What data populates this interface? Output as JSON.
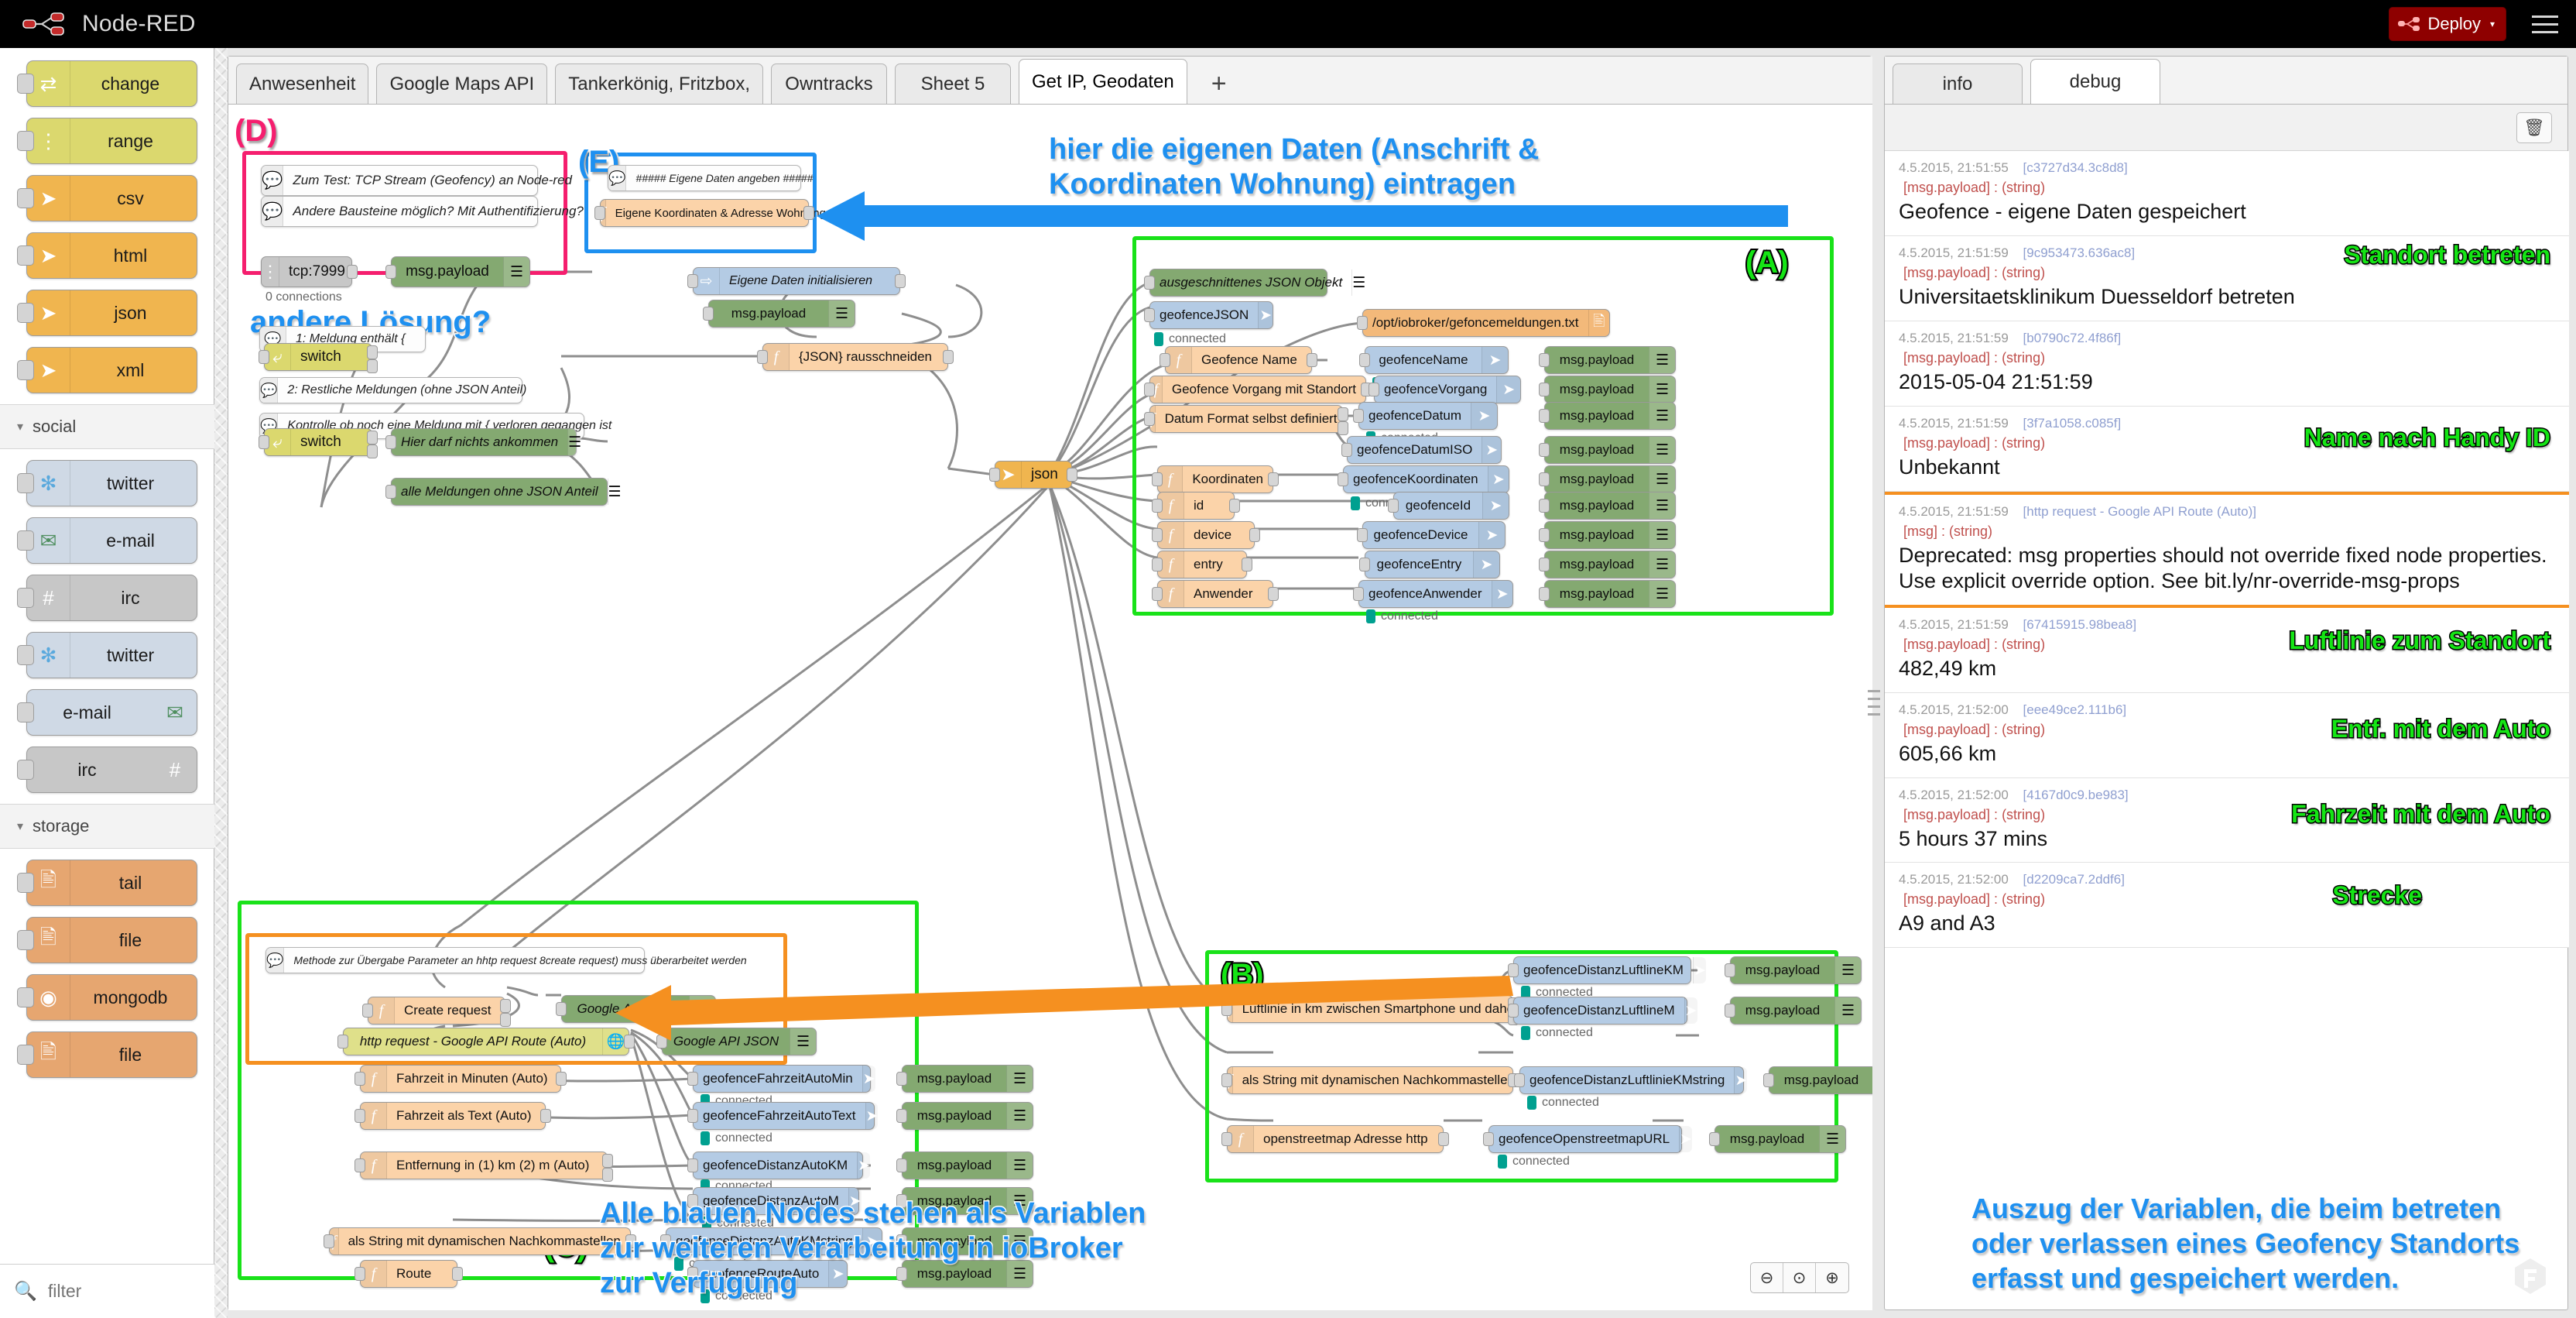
{
  "header": {
    "app_title": "Node-RED",
    "deploy_label": "Deploy",
    "deploy_caret": "▾",
    "logo_icon": "node-red-logo-icon",
    "menu_icon": "hamburger-menu-icon"
  },
  "palette": {
    "filter_placeholder": "filter",
    "filter_value": "",
    "search_icon": "search-icon",
    "groups": [
      {
        "label": "",
        "nodes": [
          {
            "label": "change",
            "color": "yellow",
            "icon": "change-icon"
          },
          {
            "label": "range",
            "color": "yellow",
            "icon": "range-icon"
          },
          {
            "label": "csv",
            "color": "orange",
            "icon": "arrow-right-icon"
          },
          {
            "label": "html",
            "color": "orange",
            "icon": "arrow-right-icon"
          },
          {
            "label": "json",
            "color": "orange",
            "icon": "arrow-right-icon"
          },
          {
            "label": "xml",
            "color": "orange",
            "icon": "arrow-right-icon"
          }
        ]
      },
      {
        "label": "social",
        "caret": "▾",
        "nodes": [
          {
            "label": "twitter",
            "color": "lightblue",
            "icon": "twitter-icon"
          },
          {
            "label": "e-mail",
            "color": "lightblue",
            "icon": "envelope-icon"
          },
          {
            "label": "irc",
            "color": "grey",
            "icon": "hash-icon"
          },
          {
            "label": "twitter",
            "color": "lightblue",
            "icon": "twitter-icon"
          },
          {
            "label": "e-mail",
            "color": "lightblue",
            "icon": "envelope-icon"
          },
          {
            "label": "irc",
            "color": "grey",
            "icon": "hash-icon"
          }
        ]
      },
      {
        "label": "storage",
        "caret": "▾",
        "nodes": [
          {
            "label": "tail",
            "color": "tan",
            "icon": "file-icon"
          },
          {
            "label": "file",
            "color": "tan",
            "icon": "file-icon"
          },
          {
            "label": "mongodb",
            "color": "tan",
            "icon": "db-icon"
          },
          {
            "label": "file",
            "color": "tan",
            "icon": "file-icon"
          }
        ]
      }
    ]
  },
  "editor": {
    "tabs": [
      {
        "label": "Anwesenheit",
        "active": false
      },
      {
        "label": "Google Maps API",
        "active": false
      },
      {
        "label": "Tankerkönig, Fritzbox,",
        "active": false
      },
      {
        "label": "Owntracks",
        "active": false
      },
      {
        "label": "Sheet 5",
        "active": false
      },
      {
        "label": "Get IP, Geodaten",
        "active": true
      }
    ],
    "add_tab_label": "+",
    "zoom_controls": [
      {
        "icon": "zoom-out-icon",
        "glyph": "⊖"
      },
      {
        "icon": "zoom-reset-icon",
        "glyph": "⊙"
      },
      {
        "icon": "zoom-in-icon",
        "glyph": "⊕"
      }
    ],
    "group_labels": {
      "a": "(A)",
      "b": "(B)",
      "c": "(C)",
      "d": "(D)",
      "e": "(E)"
    },
    "annotations": {
      "eigene_daten": "hier die eigenen Daten (Anschrift &\nKoordinaten Wohnung) eintragen",
      "andere_loesung": "andere Lösung?",
      "blaue_nodes": "Alle blauen Nodes stehen als Variablen\nzur weiteren Verarbeitung in ioBroker\nzur Verfügung"
    },
    "nodes": {
      "tcp_comment_1": "Zum Test: TCP Stream (Geofency) an Node-red",
      "tcp_comment_2": "Andere Bausteine möglich? Mit Authentifizierung?",
      "tcp_in": "tcp:7999",
      "tcp_status": "0 connections",
      "tcp_debug": "msg.payload",
      "e_comment": "##### Eigene Daten angeben #####",
      "e_func": "Eigene Koordinaten & Adresse Wohnung",
      "init_inject": "Eigene Daten initialisieren",
      "init_debug": "msg.payload",
      "sw1_comment": "1: Meldung enthält {",
      "sw1": "switch",
      "sw1_comment2": "2: Restliche Meldungen (ohne JSON Anteil)",
      "json_cut": "{JSON} rausschneiden",
      "sw2_comment": "Kontrolle ob noch eine Meldung mit { verloren gegangen ist",
      "sw2": "switch",
      "sw2_debug1": "Hier darf nichts ankommen",
      "sw2_debug2": "alle Meldungen ohne JSON Anteil",
      "json_node": "json",
      "a_debug_cut": "ausgeschnittenes JSON Objekt",
      "a_var_json": "geofenceJSON",
      "a_file": "/opt/iobroker/gefoncemeldungen.txt",
      "connected": "connected",
      "rows_a": [
        {
          "func": "Geofence Name",
          "var": "geofenceName",
          "debug": "msg.payload"
        },
        {
          "func": "Geofence Vorgang mit Standort",
          "var": "geofenceVorgang",
          "debug": "msg.payload"
        },
        {
          "func": "Datum Format selbst definiert",
          "var": "geofenceDatum",
          "debug": "msg.payload"
        },
        {
          "func": "",
          "var": "geofenceDatumISO",
          "debug": "msg.payload"
        },
        {
          "func": "Koordinaten",
          "var": "geofenceKoordinaten",
          "debug": "msg.payload"
        },
        {
          "func": "id",
          "var": "geofenceId",
          "debug": "msg.payload"
        },
        {
          "func": "device",
          "var": "geofenceDevice",
          "debug": "msg.payload"
        },
        {
          "func": "entry",
          "var": "geofenceEntry",
          "debug": "msg.payload"
        },
        {
          "func": "Anwender",
          "var": "geofenceAnwender",
          "debug": "msg.payload"
        }
      ],
      "c_comment": "Methode zur Übergabe Parameter an hhtp request 8create request) muss überarbeitet werden",
      "c_create_request": "Create request",
      "c_google_url_debug": "Google API URL",
      "c_http_request": "http request - Google API Route (Auto)",
      "c_google_json_debug": "Google API JSON",
      "rows_c": [
        {
          "func": "Fahrzeit in Minuten (Auto)",
          "var": "geofenceFahrzeitAutoMin",
          "debug": "msg.payload"
        },
        {
          "func": "Fahrzeit als Text (Auto)",
          "var": "geofenceFahrzeitAutoText",
          "debug": "msg.payload"
        },
        {
          "func": "Entfernung in (1) km (2) m (Auto)",
          "var": "geofenceDistanzAutoKM",
          "debug": "msg.payload"
        },
        {
          "func": "",
          "var": "geofenceDistanzAutoM",
          "debug": "msg.payload"
        },
        {
          "func": "als String mit dynamischen Nachkommastellen",
          "var": "geofenceDistanzAutoKMstring",
          "debug": "msg.payload"
        },
        {
          "func": "Route",
          "var": "geofenceRouteAuto",
          "debug": "msg.payload"
        }
      ],
      "rows_b": [
        {
          "func": "Luftlinie in km zwischen Smartphone und daheim",
          "var": "geofenceDistanzLuftlineKM",
          "debug": "msg.payload"
        },
        {
          "func": "",
          "var": "geofenceDistanzLuftlineM",
          "debug": "msg.payload"
        },
        {
          "func": "als String mit dynamischen Nachkommastellen",
          "var": "geofenceDistanzLuftlinieKMstring",
          "debug": "msg.payload"
        },
        {
          "func": "openstreetmap Adresse http",
          "var": "geofenceOpenstreetmapURL",
          "debug": "msg.payload"
        }
      ]
    }
  },
  "sidebar": {
    "tabs": [
      {
        "label": "info",
        "active": false
      },
      {
        "label": "debug",
        "active": true
      }
    ],
    "trash_icon": "trash-icon",
    "messages": [
      {
        "time": "4.5.2015, 21:51:55",
        "topic": "[c3727d34.3c8d8]",
        "prop": "[msg.payload] : (string)",
        "value": "Geofence - eigene Daten gespeichert",
        "highlight": false,
        "annot": ""
      },
      {
        "time": "4.5.2015, 21:51:59",
        "topic": "[9c953473.636ac8]",
        "prop": "[msg.payload] : (string)",
        "value": "Universitaetsklinikum Duesseldorf betreten",
        "highlight": false,
        "annot": "Standort betreten"
      },
      {
        "time": "4.5.2015, 21:51:59",
        "topic": "[b0790c72.4f86f]",
        "prop": "[msg.payload] : (string)",
        "value": "2015-05-04 21:51:59",
        "highlight": false,
        "annot": ""
      },
      {
        "time": "4.5.2015, 21:51:59",
        "topic": "[3f7a1058.c085f]",
        "prop": "[msg.payload] : (string)",
        "value": "Unbekannt",
        "highlight": false,
        "annot": "Name nach Handy ID"
      },
      {
        "time": "4.5.2015, 21:51:59",
        "topic": "[http request - Google API Route (Auto)]",
        "prop": "[msg] : (string)",
        "value": "Deprecated: msg properties should not override fixed node properties. Use explicit override option. See bit.ly/nr-override-msg-props",
        "highlight": true,
        "annot": ""
      },
      {
        "time": "4.5.2015, 21:51:59",
        "topic": "[67415915.98bea8]",
        "prop": "[msg.payload] : (string)",
        "value": "482,49 km",
        "highlight": false,
        "annot": "Luftlinie zum Standort"
      },
      {
        "time": "4.5.2015, 21:52:00",
        "topic": "[eee49ce2.111b6]",
        "prop": "[msg.payload] : (string)",
        "value": "605,66 km",
        "highlight": false,
        "annot": "Entf. mit dem Auto"
      },
      {
        "time": "4.5.2015, 21:52:00",
        "topic": "[4167d0c9.be983]",
        "prop": "[msg.payload] : (string)",
        "value": "5 hours 37 mins",
        "highlight": false,
        "annot": "Fahrzeit mit dem Auto"
      },
      {
        "time": "4.5.2015, 21:52:00",
        "topic": "[d2209ca7.2ddf6]",
        "prop": "[msg.payload] : (string)",
        "value": "A9 and A3",
        "highlight": false,
        "annot": "Strecke"
      }
    ],
    "bottom_note": "Auszug der Variablen, die beim betreten oder verlassen eines Geofency Standorts erfasst und gespeichert werden.",
    "resize_icon": "resize-handle-icon",
    "footer_icon": "fd-logo-icon"
  },
  "colors": {
    "brand_red": "#8e0000",
    "annot_blue": "#1e90f0",
    "annot_green": "#15e515",
    "group_green": "#19e219",
    "group_pink": "#f51e6e",
    "group_orange": "#f59020",
    "status_connected": "#00a090"
  }
}
